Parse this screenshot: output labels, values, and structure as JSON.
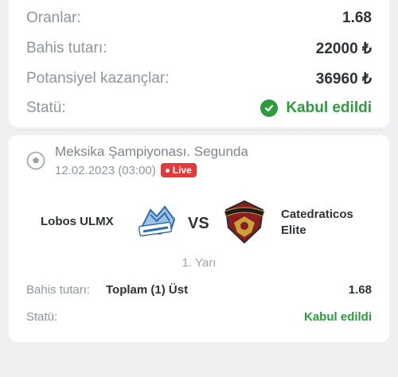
{
  "summary": {
    "odds_label": "Oranlar:",
    "odds_value": "1.68",
    "stake_label": "Bahis tutarı:",
    "stake_value": "22000 ₺",
    "winnings_label": "Potansiyel kazançlar:",
    "winnings_value": "36960 ₺",
    "status_label": "Statü:",
    "status_value": "Kabul edildi",
    "status_icon": "check-circle-icon",
    "status_color": "#2b9b3d"
  },
  "event": {
    "league": "Meksika Şampiyonası. Segunda",
    "date": "12.02.2023 (03:00)",
    "live_badge": "Live",
    "live_color": "#e03a3a",
    "team_home": "Lobos ULMX",
    "vs": "VS",
    "team_away_line1": "Catedraticos",
    "team_away_line2": "Elite",
    "period": "1. Yarı",
    "bet_label": "Bahis tutarı:",
    "bet_value": "Toplam (1) Üst",
    "bet_odds": "1.68",
    "status_label": "Statü:",
    "status_value": "Kabul edildi"
  }
}
